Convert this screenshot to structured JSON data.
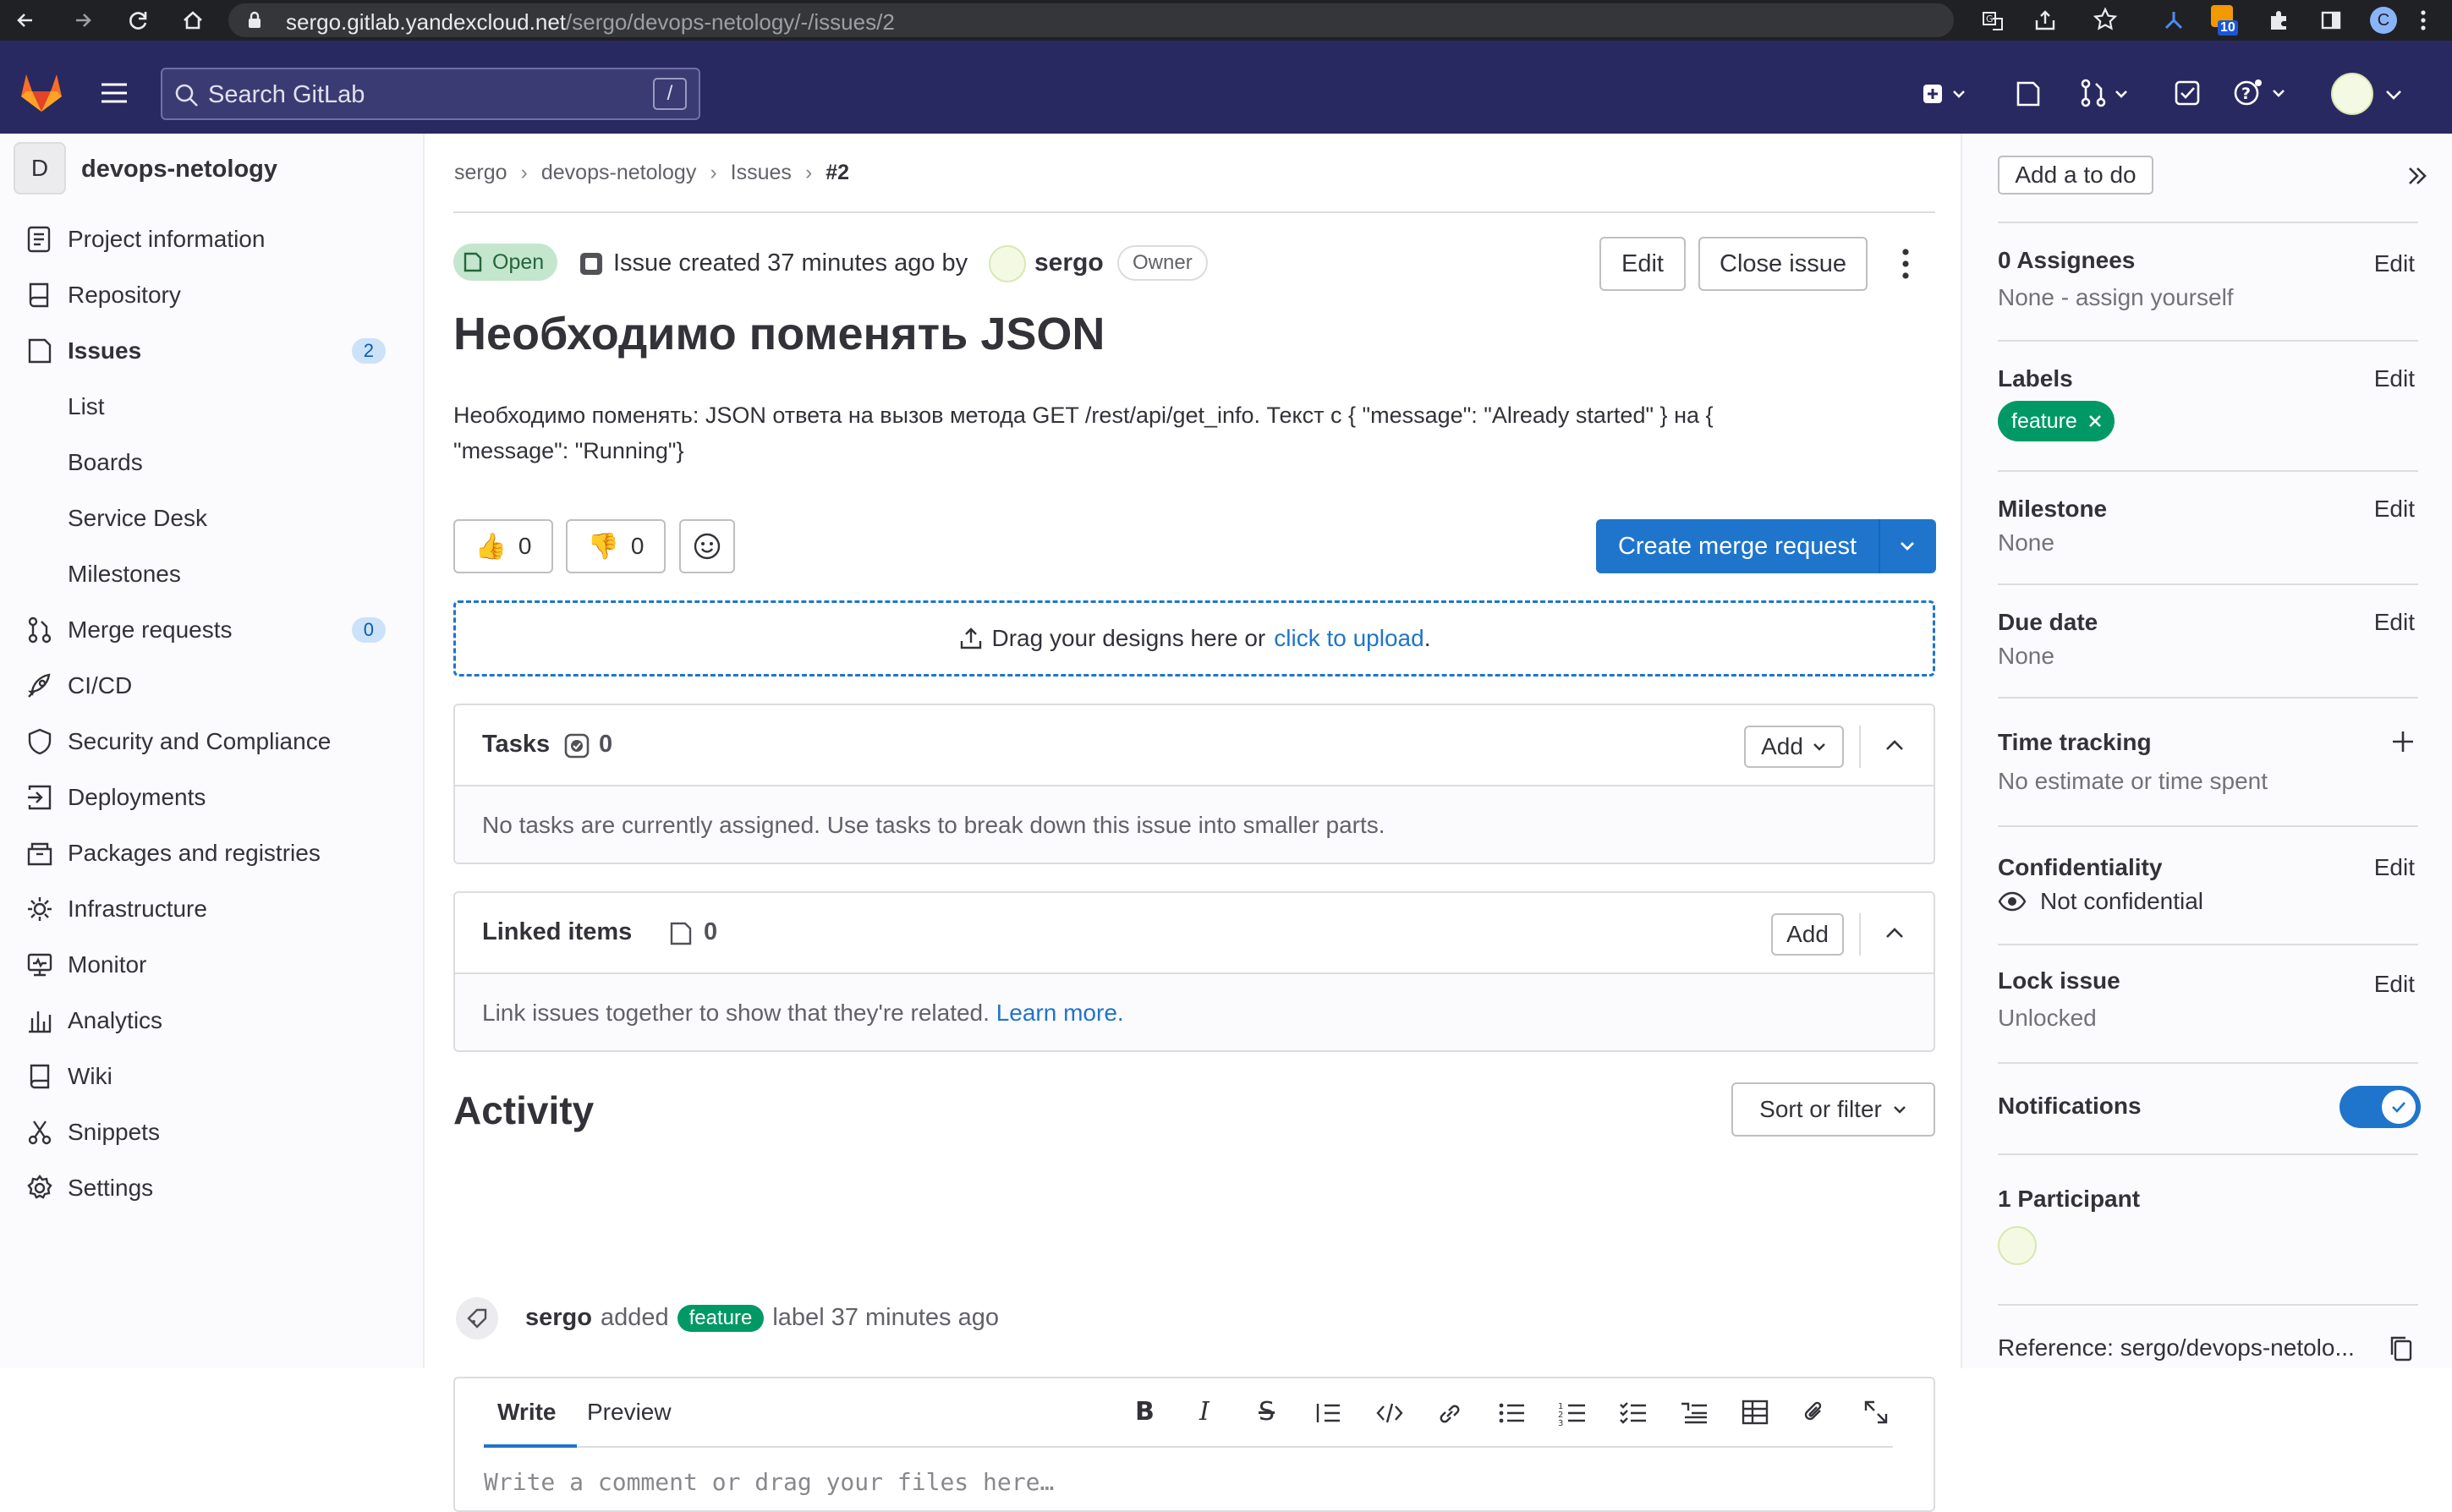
{
  "browser": {
    "url_host": "sergo.gitlab.yandexcloud.net",
    "url_path": "/sergo/devops-netology/-/issues/2",
    "ext_badge": "10",
    "profile_letter": "C"
  },
  "gitlab_header": {
    "search_placeholder": "Search GitLab",
    "search_shortcut": "/"
  },
  "project": {
    "avatar_letter": "D",
    "name": "devops-netology"
  },
  "sidebar": {
    "items": [
      {
        "label": "Project information"
      },
      {
        "label": "Repository"
      },
      {
        "label": "Issues",
        "count": "2"
      },
      {
        "label": "List"
      },
      {
        "label": "Boards"
      },
      {
        "label": "Service Desk"
      },
      {
        "label": "Milestones"
      },
      {
        "label": "Merge requests",
        "count": "0"
      },
      {
        "label": "CI/CD"
      },
      {
        "label": "Security and Compliance"
      },
      {
        "label": "Deployments"
      },
      {
        "label": "Packages and registries"
      },
      {
        "label": "Infrastructure"
      },
      {
        "label": "Monitor"
      },
      {
        "label": "Analytics"
      },
      {
        "label": "Wiki"
      },
      {
        "label": "Snippets"
      },
      {
        "label": "Settings"
      }
    ]
  },
  "breadcrumb": [
    "sergo",
    "devops-netology",
    "Issues",
    "#2"
  ],
  "issue": {
    "status": "Open",
    "created_text": "Issue created 37 minutes ago by",
    "author": "sergo",
    "author_role": "Owner",
    "edit_label": "Edit",
    "close_label": "Close issue",
    "title": "Необходимо поменять JSON",
    "description_line1": "Необходимо поменять: JSON ответа на вызов метода GET /rest/api/get_info. Текст с { \"message\": \"Already started\" } на {",
    "description_line2": "\"message\": \"Running\"}",
    "thumbs_up": "0",
    "thumbs_down": "0",
    "create_mr_label": "Create merge request",
    "upload_text": "Drag your designs here or",
    "upload_link": "click to upload",
    "upload_period": "."
  },
  "tasks": {
    "title": "Tasks",
    "count": "0",
    "add_label": "Add",
    "empty_text": "No tasks are currently assigned. Use tasks to break down this issue into smaller parts."
  },
  "linked": {
    "title": "Linked items",
    "count": "0",
    "add_label": "Add",
    "empty_text": "Link issues together to show that they're related.",
    "learn_more": "Learn more."
  },
  "activity": {
    "title": "Activity",
    "sort_label": "Sort or filter",
    "event_user": "sergo",
    "event_action": "added",
    "event_label": "feature",
    "event_suffix": "label 37 minutes ago"
  },
  "comment": {
    "tab_write": "Write",
    "tab_preview": "Preview",
    "placeholder": "Write a comment or drag your files here…"
  },
  "right_sidebar": {
    "todo_label": "Add a to do",
    "assignees_title": "0 Assignees",
    "assignees_value": "None - assign yourself",
    "labels_title": "Labels",
    "label_chip": "feature",
    "milestone_title": "Milestone",
    "milestone_value": "None",
    "due_title": "Due date",
    "due_value": "None",
    "time_title": "Time tracking",
    "time_value": "No estimate or time spent",
    "conf_title": "Confidentiality",
    "conf_value": "Not confidential",
    "lock_title": "Lock issue",
    "lock_value": "Unlocked",
    "notif_title": "Notifications",
    "participants_title": "1 Participant",
    "reference": "Reference: sergo/devops-netolo...",
    "edit": "Edit"
  },
  "colors": {
    "header": "#292961",
    "primary": "#1f75cb",
    "open_badge_bg": "#c3e6cd",
    "label_green": "#009966"
  }
}
